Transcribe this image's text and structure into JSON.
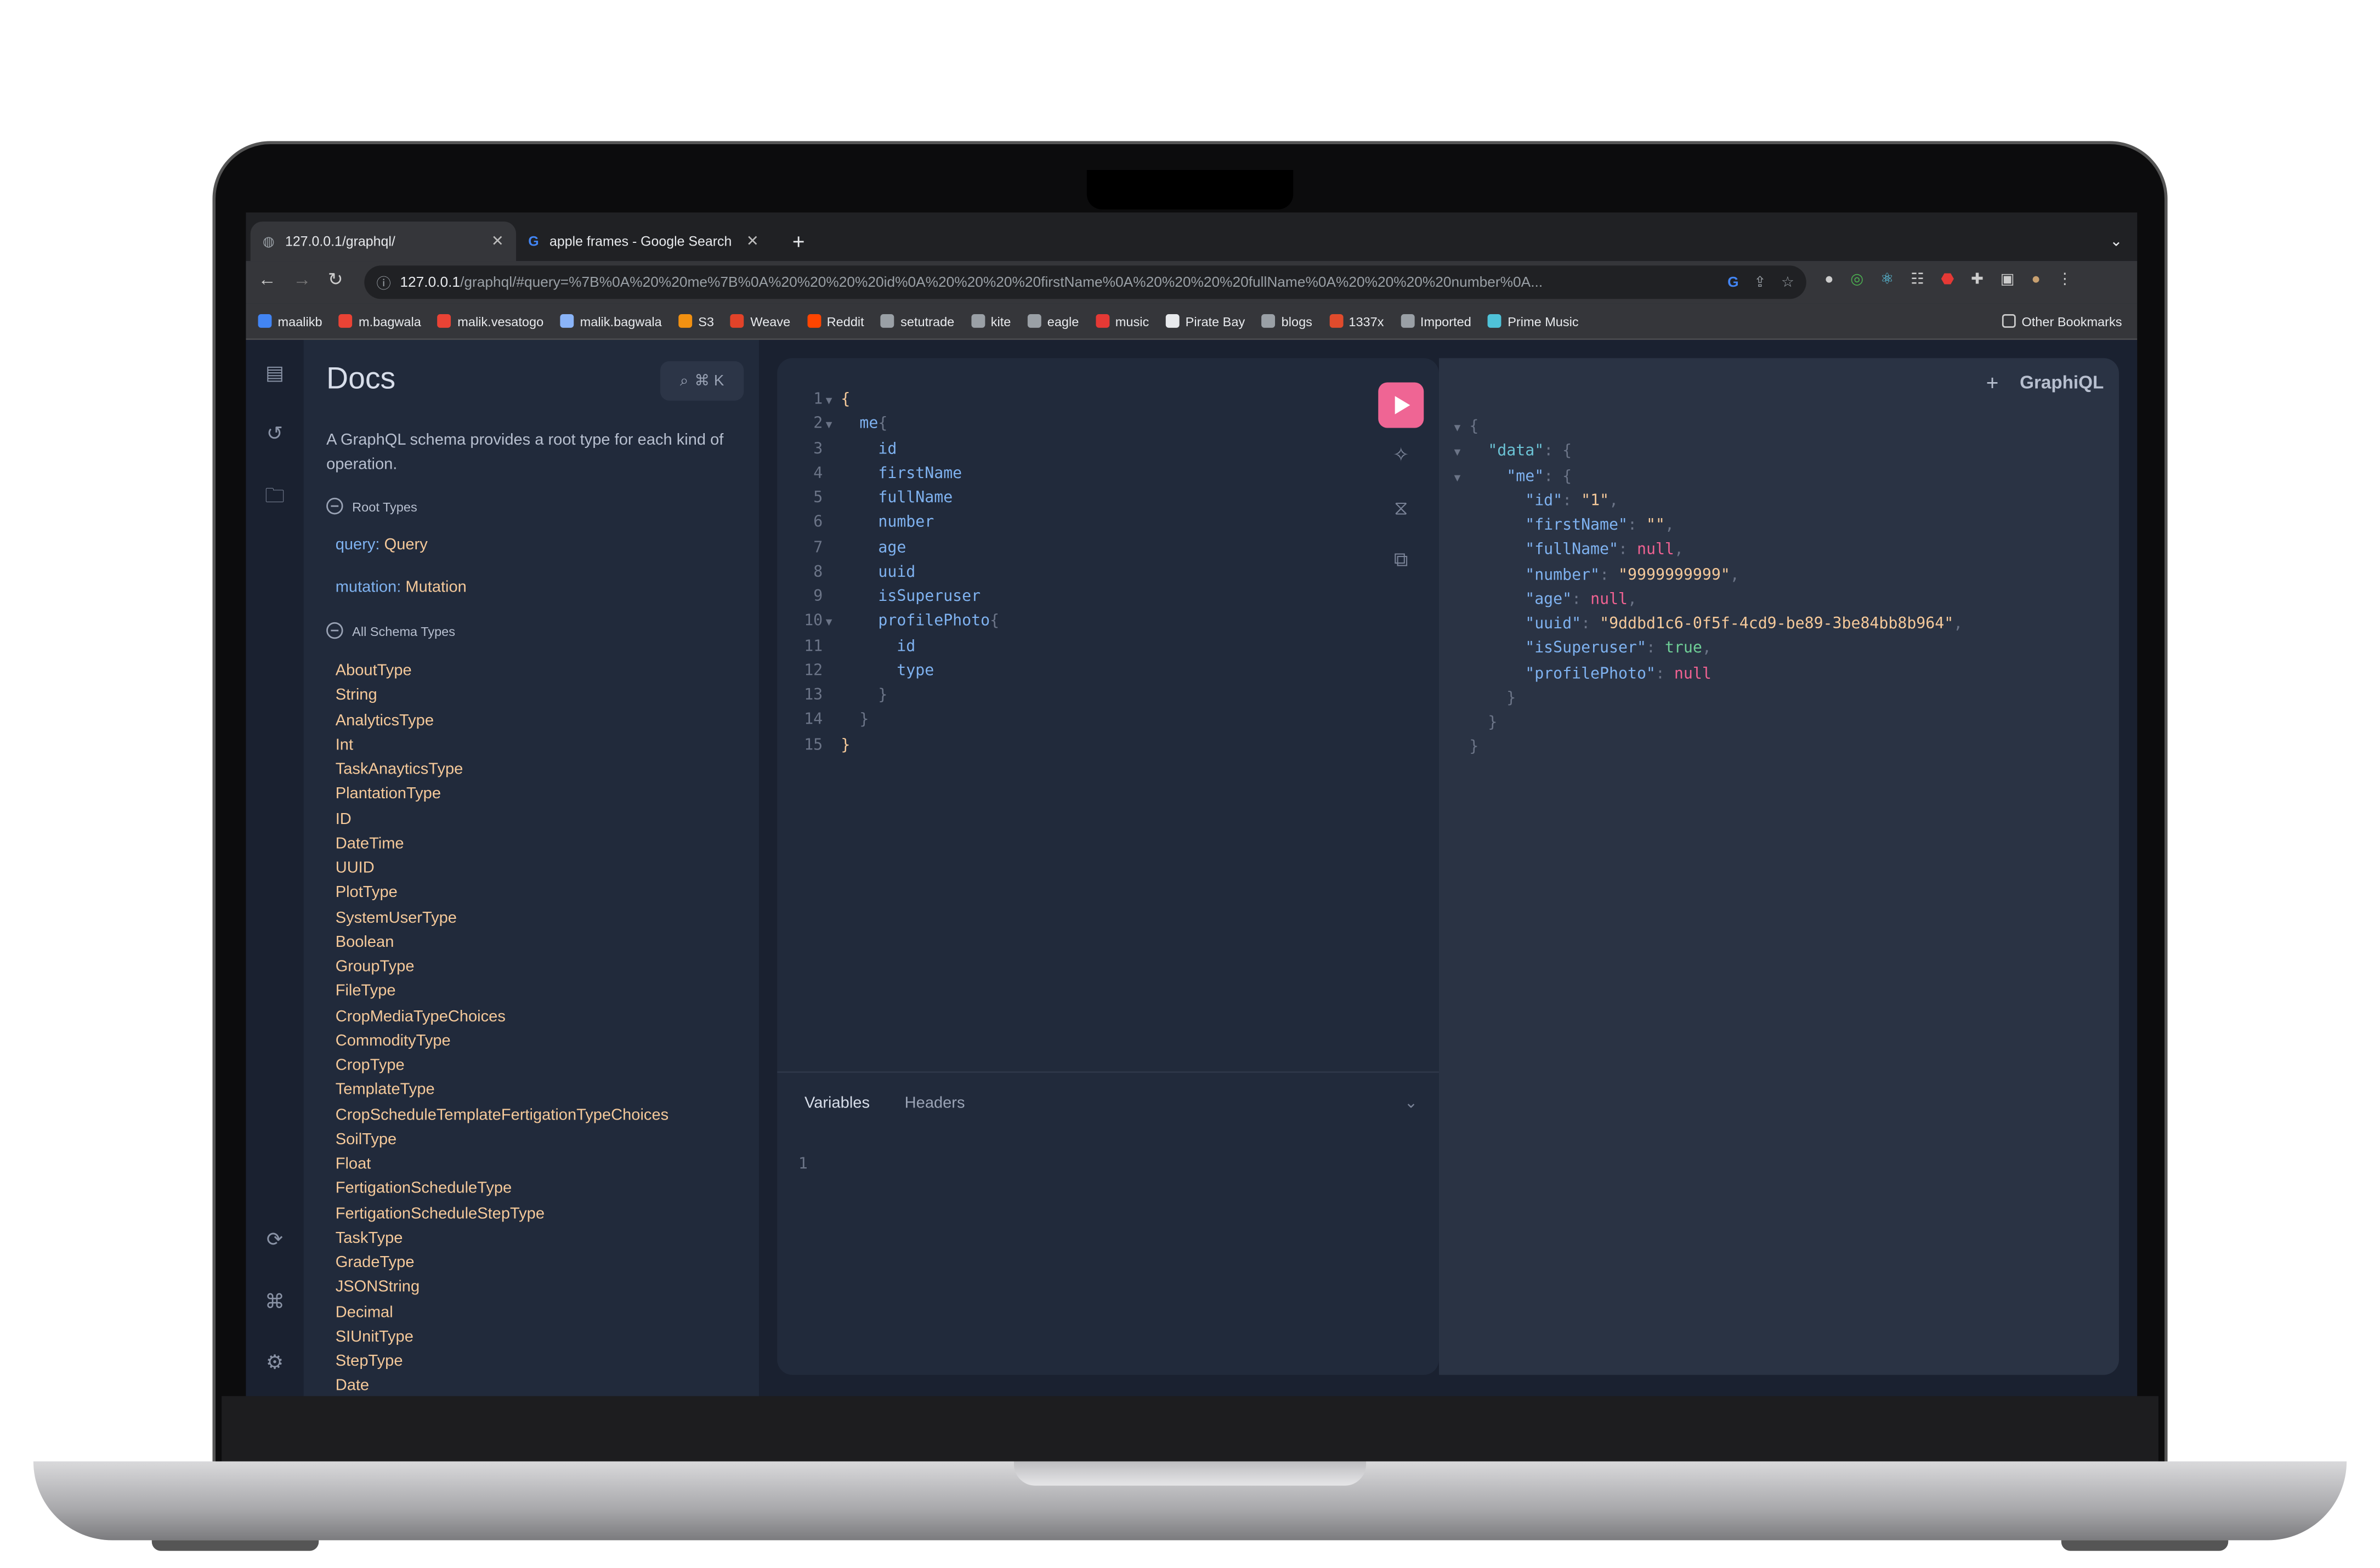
{
  "browser": {
    "tabs": [
      {
        "title": "127.0.0.1/graphql/",
        "active": true
      },
      {
        "title": "apple frames - Google Search",
        "active": false
      }
    ],
    "url_host": "127.0.0.1",
    "url_rest": "/graphql/#query=%7B%0A%20%20me%7B%0A%20%20%20%20id%0A%20%20%20%20firstName%0A%20%20%20%20fullName%0A%20%20%20%20number%0A...",
    "bookmarks": [
      {
        "label": "maalikb",
        "color": "#4285f4"
      },
      {
        "label": "m.bagwala",
        "color": "#ea4335"
      },
      {
        "label": "malik.vesatogo",
        "color": "#ea4335"
      },
      {
        "label": "malik.bagwala",
        "color": "#8ab4f8"
      },
      {
        "label": "S3",
        "color": "#f29111"
      },
      {
        "label": "Weave",
        "color": "#e24329"
      },
      {
        "label": "Reddit",
        "color": "#ff4500"
      },
      {
        "label": "setutrade",
        "color": "#9aa0a6"
      },
      {
        "label": "kite",
        "color": "#9aa0a6"
      },
      {
        "label": "eagle",
        "color": "#9aa0a6"
      },
      {
        "label": "music",
        "color": "#e53935"
      },
      {
        "label": "Pirate Bay",
        "color": "#e8eaed"
      },
      {
        "label": "blogs",
        "color": "#9aa0a6"
      },
      {
        "label": "1337x",
        "color": "#e04b2c"
      },
      {
        "label": "Imported",
        "color": "#9aa0a6"
      },
      {
        "label": "Prime Music",
        "color": "#4fc3d9"
      }
    ],
    "other_bookmarks": "Other Bookmarks"
  },
  "docs": {
    "title": "Docs",
    "search_shortcut": "⌘ K",
    "description": "A GraphQL schema provides a root type for each kind of operation.",
    "root_types_heading": "Root Types",
    "root_types": [
      {
        "field": "query",
        "type": "Query"
      },
      {
        "field": "mutation",
        "type": "Mutation"
      }
    ],
    "all_types_heading": "All Schema Types",
    "types": [
      "AboutType",
      "String",
      "AnalyticsType",
      "Int",
      "TaskAnayticsType",
      "PlantationType",
      "ID",
      "DateTime",
      "UUID",
      "PlotType",
      "SystemUserType",
      "Boolean",
      "GroupType",
      "FileType",
      "CropMediaTypeChoices",
      "CommodityType",
      "CropType",
      "TemplateType",
      "CropScheduleTemplateFertigationTypeChoices",
      "SoilType",
      "Float",
      "FertigationScheduleType",
      "FertigationScheduleStepType",
      "TaskType",
      "GradeType",
      "JSONString",
      "Decimal",
      "SIUnitType",
      "StepType",
      "Date"
    ]
  },
  "editor": {
    "lines": [
      {
        "n": "1",
        "fold": true,
        "indent": 0,
        "tokens": [
          [
            "{",
            "brace"
          ]
        ]
      },
      {
        "n": "2",
        "fold": true,
        "indent": 1,
        "tokens": [
          [
            "me",
            "field"
          ],
          [
            "{",
            "punct"
          ]
        ]
      },
      {
        "n": "3",
        "indent": 2,
        "tokens": [
          [
            "id",
            "field"
          ]
        ]
      },
      {
        "n": "4",
        "indent": 2,
        "tokens": [
          [
            "firstName",
            "field"
          ]
        ]
      },
      {
        "n": "5",
        "indent": 2,
        "tokens": [
          [
            "fullName",
            "field"
          ]
        ]
      },
      {
        "n": "6",
        "indent": 2,
        "tokens": [
          [
            "number",
            "field"
          ]
        ]
      },
      {
        "n": "7",
        "indent": 2,
        "tokens": [
          [
            "age",
            "field"
          ]
        ]
      },
      {
        "n": "8",
        "indent": 2,
        "tokens": [
          [
            "uuid",
            "field"
          ]
        ]
      },
      {
        "n": "9",
        "indent": 2,
        "tokens": [
          [
            "isSuperuser",
            "field"
          ]
        ]
      },
      {
        "n": "10",
        "fold": true,
        "indent": 2,
        "tokens": [
          [
            "profilePhoto",
            "field"
          ],
          [
            "{",
            "punct"
          ]
        ]
      },
      {
        "n": "11",
        "indent": 3,
        "tokens": [
          [
            "id",
            "field"
          ]
        ]
      },
      {
        "n": "12",
        "indent": 3,
        "tokens": [
          [
            "type",
            "field"
          ]
        ]
      },
      {
        "n": "13",
        "indent": 2,
        "tokens": [
          [
            "}",
            "punct"
          ]
        ]
      },
      {
        "n": "14",
        "indent": 1,
        "tokens": [
          [
            "}",
            "punct"
          ]
        ]
      },
      {
        "n": "15",
        "indent": 0,
        "tokens": [
          [
            "}",
            "brace"
          ]
        ]
      }
    ],
    "variables_tab": "Variables",
    "headers_tab": "Headers",
    "variables_line": "1"
  },
  "results": {
    "brand": "GraphiQL",
    "lines": [
      {
        "fold": true,
        "indent": 0,
        "tokens": [
          [
            "{",
            "punct"
          ]
        ]
      },
      {
        "fold": true,
        "indent": 1,
        "tokens": [
          [
            "\"data\"",
            "data"
          ],
          [
            ": {",
            "punct"
          ]
        ]
      },
      {
        "fold": true,
        "indent": 2,
        "tokens": [
          [
            "\"me\"",
            "key"
          ],
          [
            ": {",
            "punct"
          ]
        ]
      },
      {
        "indent": 3,
        "tokens": [
          [
            "\"id\"",
            "key"
          ],
          [
            ": ",
            "punct"
          ],
          [
            "\"1\"",
            "str"
          ],
          [
            ",",
            "punct"
          ]
        ]
      },
      {
        "indent": 3,
        "tokens": [
          [
            "\"firstName\"",
            "key"
          ],
          [
            ": ",
            "punct"
          ],
          [
            "\"\"",
            "str"
          ],
          [
            ",",
            "punct"
          ]
        ]
      },
      {
        "indent": 3,
        "tokens": [
          [
            "\"fullName\"",
            "key"
          ],
          [
            ": ",
            "punct"
          ],
          [
            "null",
            "null"
          ],
          [
            ",",
            "punct"
          ]
        ]
      },
      {
        "indent": 3,
        "tokens": [
          [
            "\"number\"",
            "key"
          ],
          [
            ": ",
            "punct"
          ],
          [
            "\"9999999999\"",
            "str"
          ],
          [
            ",",
            "punct"
          ]
        ]
      },
      {
        "indent": 3,
        "tokens": [
          [
            "\"age\"",
            "key"
          ],
          [
            ": ",
            "punct"
          ],
          [
            "null",
            "null"
          ],
          [
            ",",
            "punct"
          ]
        ]
      },
      {
        "indent": 3,
        "tokens": [
          [
            "\"uuid\"",
            "key"
          ],
          [
            ": ",
            "punct"
          ],
          [
            "\"9ddbd1c6-0f5f-4cd9-be89-3be84bb8b964\"",
            "str"
          ],
          [
            ",",
            "punct"
          ]
        ]
      },
      {
        "indent": 3,
        "tokens": [
          [
            "\"isSuperuser\"",
            "key"
          ],
          [
            ": ",
            "punct"
          ],
          [
            "true",
            "bool"
          ],
          [
            ",",
            "punct"
          ]
        ]
      },
      {
        "indent": 3,
        "tokens": [
          [
            "\"profilePhoto\"",
            "key"
          ],
          [
            ": ",
            "punct"
          ],
          [
            "null",
            "null"
          ]
        ]
      },
      {
        "indent": 2,
        "tokens": [
          [
            "}",
            "punct"
          ]
        ]
      },
      {
        "indent": 1,
        "tokens": [
          [
            "}",
            "punct"
          ]
        ]
      },
      {
        "indent": 0,
        "tokens": [
          [
            "}",
            "punct"
          ]
        ]
      }
    ]
  }
}
